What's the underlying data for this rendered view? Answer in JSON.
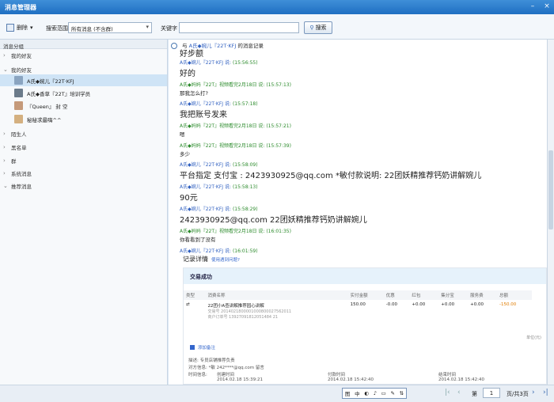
{
  "window": {
    "title": "消息管理器",
    "minimize": "–",
    "close": "×"
  },
  "toolbar": {
    "delete_label": "删除",
    "search_scope_label": "搜索范围",
    "search_scope_value": "所有消息 (不含群)",
    "keyword_label": "关键字",
    "keyword_value": "",
    "search_button": "搜索"
  },
  "sidebar": {
    "header": "消息分组",
    "groups": [
      {
        "label": "我的好友",
        "expanded": false
      },
      {
        "label": "我的好友",
        "expanded": true
      },
      {
        "label": "陌生人",
        "expanded": false
      },
      {
        "label": "黑名单",
        "expanded": false
      },
      {
        "label": "群",
        "expanded": false
      },
      {
        "label": "系统消息",
        "expanded": false
      },
      {
        "label": "推荐消息",
        "expanded": false
      }
    ],
    "friends": [
      {
        "name": "A氏◆婉儿『22T·KFJ",
        "selected": true
      },
      {
        "name": "A氏◆香草『22T』培训学员",
        "selected": false
      },
      {
        "name": "『Queen』 封  空",
        "selected": false
      },
      {
        "name": "秘秘求最嗨^^",
        "selected": false
      }
    ]
  },
  "main": {
    "header_prefix": "与",
    "header_name": "A氏◆婉儿『22T·KFJ",
    "header_suffix": "的消息记录",
    "messages": [
      {
        "kind": "body-big",
        "text": "好步额"
      },
      {
        "kind": "meta",
        "name": "A氏◆婉儿『22T·KFJ 说:",
        "time": "(15:56:55)"
      },
      {
        "kind": "body-big",
        "text": "好的"
      },
      {
        "kind": "meta",
        "name": "A氏◆妈妈『22T』视频看完2月18日 说:",
        "time": "(15:57:13)"
      },
      {
        "kind": "body-sm",
        "text": "那我怎么打?"
      },
      {
        "kind": "meta",
        "name": "A氏◆婉儿『22T·KFJ 说:",
        "time": "(15:57:18)"
      },
      {
        "kind": "body-big",
        "text": "我把账号发来"
      },
      {
        "kind": "meta",
        "name": "A氏◆妈妈『22T』视频看完2月18日 说:",
        "time": "(15:57:21)"
      },
      {
        "kind": "body-sm",
        "text": "嗯"
      },
      {
        "kind": "meta",
        "name": "A氏◆妈妈『22T』视频看完2月18日 说:",
        "time": "(15:57:39)"
      },
      {
        "kind": "body-sm",
        "text": "多少"
      },
      {
        "kind": "meta",
        "name": "A氏◆婉儿『22T·KFJ 说:",
        "time": "(15:58:09)"
      },
      {
        "kind": "body-big",
        "text": "平台指定 支付宝 : 2423930925@qq.com *敏付款说明:  22团妖精推荐钙奶讲解婉儿"
      },
      {
        "kind": "meta",
        "name": "A氏◆婉儿『22T·KFJ 说:",
        "time": "(15:58:13)"
      },
      {
        "kind": "body-big",
        "text": "90元"
      },
      {
        "kind": "meta",
        "name": "A氏◆婉儿『22T·KFJ 说:",
        "time": "(15:58:29)"
      },
      {
        "kind": "body-big",
        "text": "2423930925@qq.com                    22团妖精推荐钙奶讲解婉儿"
      },
      {
        "kind": "meta",
        "name": "A氏◆妈妈『22T』视频看完2月18日 说:",
        "time": "(16:01:35)"
      },
      {
        "kind": "body-sm",
        "text": "你看看到了没有"
      },
      {
        "kind": "meta",
        "name": "A氏◆婉儿『22T·KFJ 说:",
        "time": "(16:01:59)"
      }
    ],
    "record": {
      "title": "记录详情",
      "link": "使用遇到问题?"
    },
    "trade": {
      "status": "交易成功",
      "columns": [
        "类型",
        "消费名称",
        "实付金额",
        "优惠",
        "红包",
        "集分宝",
        "服务费",
        "总额"
      ],
      "row": {
        "name": "22团小A查讲解推荐园心讲解",
        "sub1": "交易号 2014021800001000800027562011",
        "sub2": "商户订单号 13927091812051484 21",
        "paid": "150.00",
        "discount": "-0.00",
        "redpack": "+0.00",
        "jifenbao": "+0.00",
        "fee": "+0.00",
        "total": "-150.00"
      },
      "unit": "单位(元)",
      "add_remark": "添加备注",
      "note_label": "描述:",
      "note_value": "专员店铺推荐负责",
      "partner_label": "对方信息:",
      "partner_value": "*敏 242****@qq.com 留言",
      "time_label": "时间信息:",
      "created_label": "创建时间",
      "created": "2014.02.18 15:39:21",
      "paid_label": "付款时间",
      "paid_time": "2014.02.18 15:42:40",
      "end_label": "结束时间",
      "end_time": "2014.02.18 15:42:40"
    }
  },
  "footer": {
    "tools": [
      "图",
      "中",
      "◐",
      "♪",
      "▭",
      "✎",
      "⇅"
    ],
    "page_prefix": "第",
    "page_value": "1",
    "page_suffix": "页/共3页"
  }
}
